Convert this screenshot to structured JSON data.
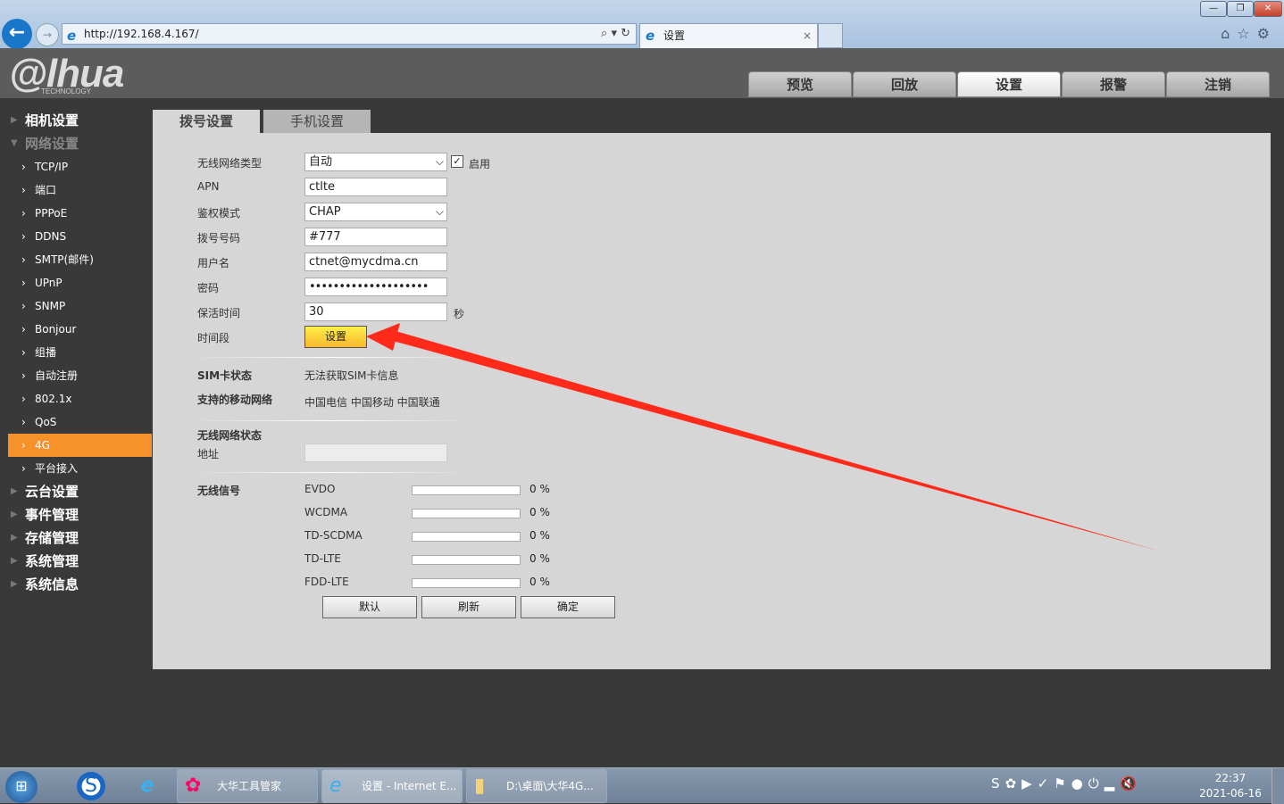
{
  "browser": {
    "url": "http://192.168.4.167/",
    "tab_title": "设置",
    "tab_close": "×",
    "back": "←",
    "forward": "→",
    "search_icons": "⌕ ▾ ↻",
    "toolbar_icons": "⌂☆⚙",
    "win": [
      "—",
      "❐",
      "✕"
    ]
  },
  "header": {
    "logo": "alhua",
    "logo_sub": "TECHNOLOGY",
    "nav": [
      "预览",
      "回放",
      "设置",
      "报警",
      "注销"
    ],
    "active_nav": "设置"
  },
  "sidebar": {
    "sections_top": [
      {
        "label": "相机设置"
      },
      {
        "label": "网络设置"
      }
    ],
    "network_items": [
      "TCP/IP",
      "端口",
      "PPPoE",
      "DDNS",
      "SMTP(邮件)",
      "UPnP",
      "SNMP",
      "Bonjour",
      "组播",
      "自动注册",
      "802.1x",
      "QoS",
      "4G",
      "平台接入"
    ],
    "selected": "4G",
    "sections_bottom": [
      "云台设置",
      "事件管理",
      "存储管理",
      "系统管理",
      "系统信息"
    ]
  },
  "content": {
    "tabs": [
      "拨号设置",
      "手机设置"
    ],
    "active_tab": "拨号设置",
    "form": {
      "network_type_label": "无线网络类型",
      "network_type_value": "自动",
      "enable_label": "启用",
      "enable_checked": true,
      "apn_label": "APN",
      "apn_value": "ctlte",
      "auth_label": "鉴权模式",
      "auth_value": "CHAP",
      "dial_label": "拨号号码",
      "dial_value": "#777",
      "user_label": "用户名",
      "user_value": "ctnet@mycdma.cn",
      "password_label": "密码",
      "password_value": "••••••••••••••••••••",
      "keepalive_label": "保活时间",
      "keepalive_value": "30",
      "keepalive_unit": "秒",
      "period_label": "时间段",
      "period_button": "设置"
    },
    "sim_label": "SIM卡状态",
    "sim_value": "无法获取SIM卡信息",
    "networks_label": "支持的移动网络",
    "networks_value": "中国电信 中国移动 中国联通",
    "wireless_status_label": "无线网络状态",
    "address_label": "地址",
    "address_value": "",
    "signal_label": "无线信号",
    "signals": [
      {
        "name": "EVDO",
        "percent": 0,
        "text": "0 %"
      },
      {
        "name": "WCDMA",
        "percent": 0,
        "text": "0 %"
      },
      {
        "name": "TD-SCDMA",
        "percent": 0,
        "text": "0 %"
      },
      {
        "name": "TD-LTE",
        "percent": 0,
        "text": "0 %"
      },
      {
        "name": "FDD-LTE",
        "percent": 0,
        "text": "0 %"
      }
    ],
    "buttons": {
      "default": "默认",
      "refresh": "刷新",
      "ok": "确定"
    },
    "annotation_arrow_color": "#ff2a1a"
  },
  "taskbar": {
    "items": [
      {
        "label": "大华工具管家"
      },
      {
        "label": "设置 - Internet E..."
      },
      {
        "label": "D:\\桌面\\大华4G..."
      }
    ],
    "time": "22:37",
    "date": "2021-06-16",
    "tray_icons": "S✿▶✓⚑●⏻▂🔇"
  }
}
